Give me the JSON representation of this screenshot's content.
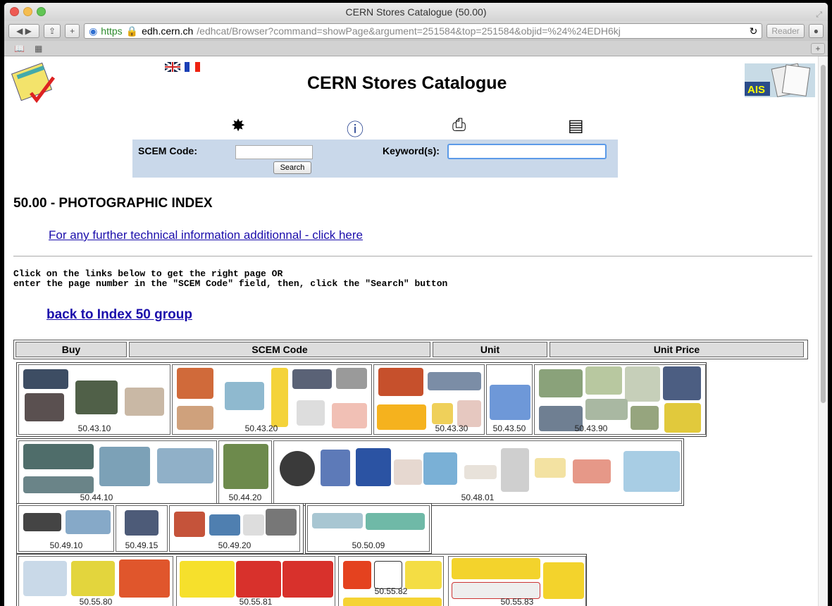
{
  "window": {
    "title": "CERN Stores Catalogue (50.00)"
  },
  "toolbar": {
    "url_scheme": "https",
    "url_host": "edh.cern.ch",
    "url_path": "/edhcat/Browser?command=showPage&argument=251584&top=251584&objid=%24%24EDH6kj",
    "reader_label": "Reader"
  },
  "header": {
    "title": "CERN Stores Catalogue"
  },
  "search": {
    "scem_label": "SCEM Code:",
    "keyword_label": "Keyword(s):",
    "button_label": "Search"
  },
  "content": {
    "section_title": "50.00 - PHOTOGRAPHIC INDEX",
    "tech_link": "For any further technical information additionnal - click here",
    "instructions": "Click on the links below to get the right page OR\nenter the page number in the \"SCEM Code\" field, then, click the \"Search\" button",
    "back_link": "back to Index 50 group"
  },
  "table": {
    "columns": [
      "Buy",
      "SCEM Code",
      "Unit",
      "Unit Price"
    ]
  },
  "codes": {
    "c1": "50.43.10",
    "c2": "50.43.20",
    "c3": "50.43.30",
    "c4": "50.43.50",
    "c5": "50.43.90",
    "c6": "50.44.10",
    "c7": "50.44.20",
    "c8": "50.48.01",
    "c9": "50.49.10",
    "c10": "50.49.15",
    "c11": "50.49.20",
    "c12": "50.50.09",
    "c13": "50.55.80",
    "c14": "50.55.81",
    "c15": "50.55.82",
    "c16": "50.55.83"
  }
}
